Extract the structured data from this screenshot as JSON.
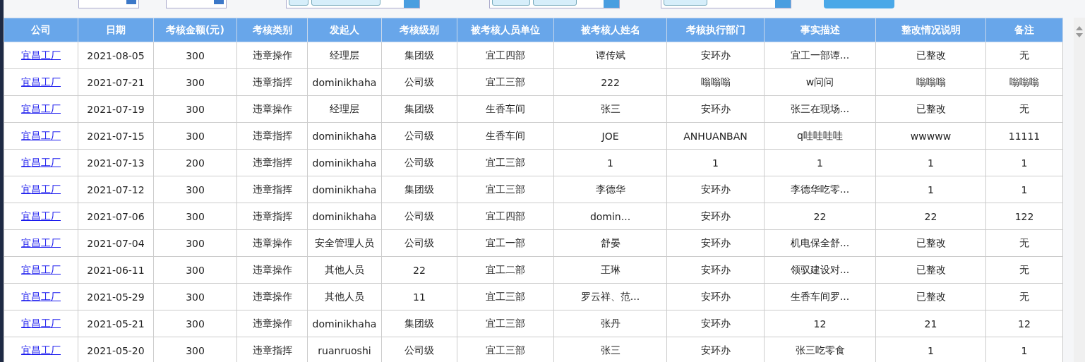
{
  "table": {
    "columns": [
      "公司",
      "日期",
      "考核金额(元)",
      "考核类别",
      "发起人",
      "考核级别",
      "被考核人员单位",
      "被考核人姓名",
      "考核执行部门",
      "事实描述",
      "整改情况说明",
      "备注"
    ],
    "rows": [
      [
        "宜昌工厂",
        "2021-08-05",
        "300",
        "违章操作",
        "经理层",
        "集团级",
        "宜工四部",
        "谭传斌",
        "安环办",
        "宜工一部谭...",
        "已整改",
        "无"
      ],
      [
        "宜昌工厂",
        "2021-07-21",
        "300",
        "违章指挥",
        "dominikhaha",
        "公司级",
        "宜工三部",
        "222",
        "嗡嗡嗡",
        "w问问",
        "嗡嗡嗡",
        "嗡嗡嗡"
      ],
      [
        "宜昌工厂",
        "2021-07-19",
        "300",
        "违章操作",
        "经理层",
        "集团级",
        "生香车间",
        "张三",
        "安环办",
        "张三在现场...",
        "已整改",
        "无"
      ],
      [
        "宜昌工厂",
        "2021-07-15",
        "300",
        "违章指挥",
        "dominikhaha",
        "公司级",
        "生香车间",
        "JOE",
        "ANHUANBAN",
        "q哇哇哇哇",
        "wwwww",
        "11111"
      ],
      [
        "宜昌工厂",
        "2021-07-13",
        "200",
        "违章指挥",
        "dominikhaha",
        "公司级",
        "宜工三部",
        "1",
        "1",
        "1",
        "1",
        "1"
      ],
      [
        "宜昌工厂",
        "2021-07-12",
        "300",
        "违章指挥",
        "dominikhaha",
        "集团级",
        "宜工三部",
        "李德华",
        "安环办",
        "李德华吃零...",
        "1",
        "1"
      ],
      [
        "宜昌工厂",
        "2021-07-06",
        "300",
        "违章指挥",
        "dominikhaha",
        "公司级",
        "宜工四部",
        "domin...",
        "安环办",
        "22",
        "22",
        "122"
      ],
      [
        "宜昌工厂",
        "2021-07-04",
        "300",
        "违章操作",
        "安全管理人员",
        "公司级",
        "宜工一部",
        "舒晏",
        "安环办",
        "机电保全舒...",
        "已整改",
        "无"
      ],
      [
        "宜昌工厂",
        "2021-06-11",
        "300",
        "违章操作",
        "其他人员",
        "22",
        "宜工二部",
        "王琳",
        "安环办",
        "领驭建设对...",
        "已整改",
        "无"
      ],
      [
        "宜昌工厂",
        "2021-05-29",
        "300",
        "违章操作",
        "其他人员",
        "11",
        "宜工三部",
        "罗云祥、范...",
        "安环办",
        "生香车间罗...",
        "已整改",
        "无"
      ],
      [
        "宜昌工厂",
        "2021-05-21",
        "300",
        "违章操作",
        "dominikhaha",
        "集团级",
        "宜工三部",
        "张丹",
        "安环办",
        "12",
        "21",
        "12"
      ],
      [
        "宜昌工厂",
        "2021-05-20",
        "300",
        "违章指挥",
        "ruanruoshi",
        "公司级",
        "宜工三部",
        "张三",
        "安环办",
        "张三吃零食",
        "1",
        "1"
      ]
    ]
  }
}
